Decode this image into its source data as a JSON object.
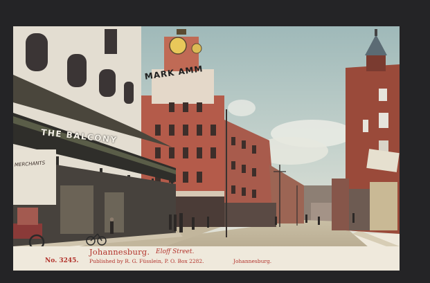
{
  "postcard": {
    "number": "No. 3245.",
    "city": "Johannesburg.",
    "street": "Eloff Street.",
    "publisher": "Published by R. G. Füsslein, P. O. Box 2282.",
    "publisher_city": "Johannesburg."
  },
  "signs": {
    "balcony": "THE BALCONY",
    "store": "MARK AMM",
    "merchants": "MERCHANTS"
  },
  "colors": {
    "caption_red": "#b2322b",
    "card_bg": "#efe9dc",
    "sky": "#aec2c2",
    "brick": "#9a4a3a"
  }
}
